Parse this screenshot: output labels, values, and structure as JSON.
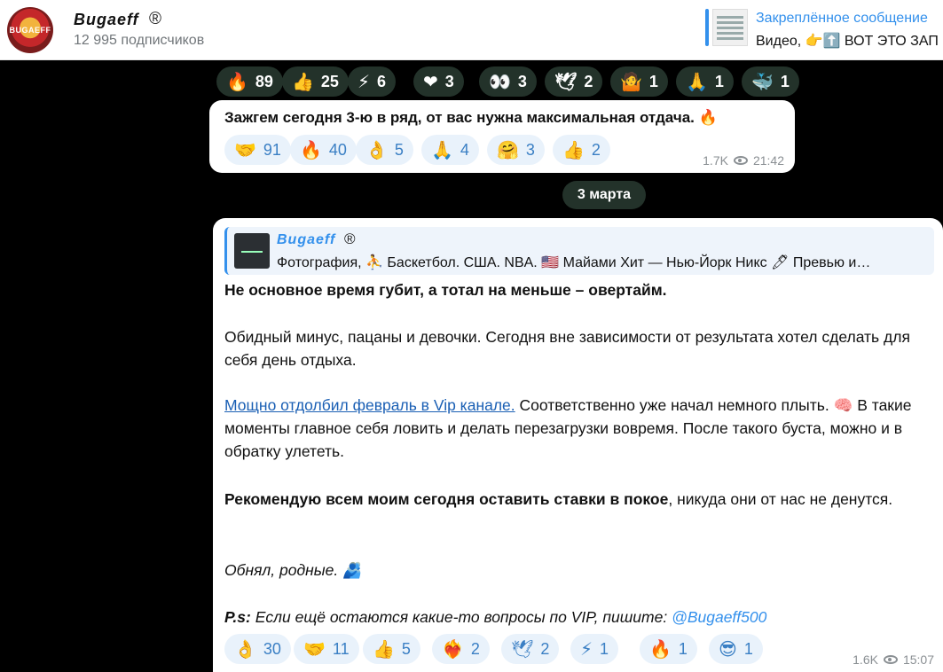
{
  "header": {
    "channel_name": "Bugaeff",
    "registered_mark": "®",
    "subscribers": "12 995 подписчиков",
    "avatar_text": "BUGAEFF",
    "pinned_title": "Закреплённое сообщение",
    "pinned_text": "Видео, 👉⬆️ ВОТ ЭТО ЗАП"
  },
  "top_reactions": [
    {
      "emoji": "🔥",
      "count": "89"
    },
    {
      "emoji": "👍",
      "count": "25"
    },
    {
      "emoji": "⚡",
      "count": "6"
    },
    {
      "emoji": "❤",
      "count": "3"
    },
    {
      "emoji": "👀",
      "count": "3"
    },
    {
      "emoji": "🕊",
      "count": "2"
    },
    {
      "emoji": "🤷",
      "count": "1"
    },
    {
      "emoji": "🙏",
      "count": "1"
    },
    {
      "emoji": "🐳",
      "count": "1"
    }
  ],
  "message1": {
    "text": "Зажгем сегодня 3-ю в ряд, от вас нужна максимальная отдача. 🔥",
    "reactions": [
      {
        "emoji": "🤝",
        "count": "91"
      },
      {
        "emoji": "🔥",
        "count": "40"
      },
      {
        "emoji": "👌",
        "count": "5"
      },
      {
        "emoji": "🙏",
        "count": "4"
      },
      {
        "emoji": "🤗",
        "count": "3"
      },
      {
        "emoji": "👍",
        "count": "2"
      }
    ],
    "views": "1.7K",
    "time": "21:42"
  },
  "date_separator": "3 марта",
  "message2": {
    "forward_name": "Bugaeff",
    "forward_reg": "®",
    "forward_desc": "Фотография, ⛹ Баскетбол. США. NBA.  🇺🇸 Майами Хит — Нью-Йорк Никс 🖊 Превью и…",
    "p1": "Не основное время губит, а тотал на меньше – овертайм.",
    "p2": "Обидный минус, пацаны и девочки. Сегодня вне зависимости от результата хотел сделать для себя день отдыха.",
    "p3_link": "Мощно отдолбил февраль в Vip канале.",
    "p3_rest": " Соответственно уже начал немного плыть. 🧠 В такие моменты главное себя ловить и делать перезагрузки вовремя. После такого буста, можно и в обратку улететь.",
    "p4_bold": "Рекомендую всем моим сегодня оставить ставки в покое",
    "p4_rest": ", никуда они от нас не денутся.",
    "p5": "Обнял, родные. 🫂",
    "p6_prefix": "P.s:",
    "p6_text": " Если ещё остаются какие-то вопросы по VIP,  пишите: ",
    "p6_mention": "@Bugaeff500",
    "reactions": [
      {
        "emoji": "👌",
        "count": "30"
      },
      {
        "emoji": "🤝",
        "count": "11"
      },
      {
        "emoji": "👍",
        "count": "5"
      },
      {
        "emoji": "❤‍🔥",
        "count": "2"
      },
      {
        "emoji": "🕊",
        "count": "2"
      },
      {
        "emoji": "⚡",
        "count": "1"
      },
      {
        "emoji": "🔥",
        "count": "1"
      },
      {
        "emoji": "😎",
        "count": "1"
      }
    ],
    "views": "1.6K",
    "time": "15:07"
  }
}
